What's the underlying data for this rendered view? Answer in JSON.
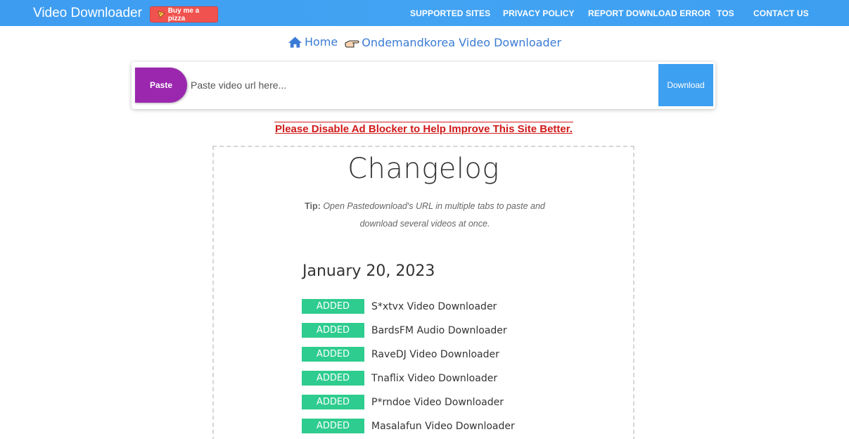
{
  "nav": {
    "brand": "Video Downloader",
    "pizza_label": "Buy me a pizza",
    "links": {
      "supported_sites": "SUPPORTED SITES",
      "privacy_policy": "PRIVACY POLICY",
      "report_error": "REPORT DOWNLOAD ERROR",
      "tos": "TOS",
      "contact_us": "CONTACT US"
    }
  },
  "breadcrumb": {
    "home": "Home",
    "current": "Ondemandkorea Video Downloader"
  },
  "search": {
    "paste_label": "Paste",
    "placeholder": "Paste video url here...",
    "download_label": "Download"
  },
  "ad_notice": "Please Disable Ad Blocker to Help Improve This Site Better.",
  "changelog": {
    "title": "Changelog",
    "tip_label": "Tip:",
    "tip_text": "Open Pastedownload's URL in multiple tabs to paste and download several videos at once.",
    "date": "January 20, 2023",
    "badge_label": "ADDED",
    "entries": [
      "S*xtvx Video Downloader",
      "BardsFM Audio Downloader",
      "RaveDJ Video Downloader",
      "Tnaflix Video Downloader",
      "P*rndoe Video Downloader",
      "Masalafun Video Downloader"
    ]
  },
  "colors": {
    "nav_bg": "#3d9cf0",
    "pizza": "#f0534f",
    "paste": "#9b27af",
    "download": "#3ea0f1",
    "badge": "#2ecc8f",
    "notice": "#d11a1a",
    "link": "#3a7bd5"
  }
}
